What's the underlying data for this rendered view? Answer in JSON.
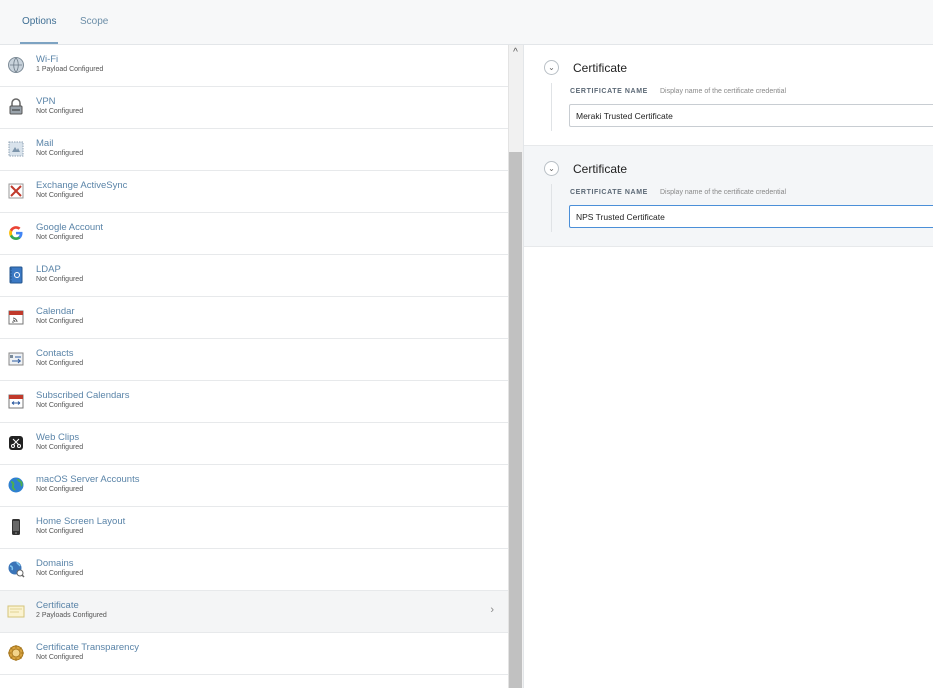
{
  "tabs": [
    {
      "label": "Options",
      "active": true
    },
    {
      "label": "Scope",
      "active": false
    }
  ],
  "payloads": [
    {
      "title": "Wi-Fi",
      "status": "1 Payload Configured",
      "icon": "wifi-globe-icon"
    },
    {
      "title": "VPN",
      "status": "Not Configured",
      "icon": "vpn-lock-icon"
    },
    {
      "title": "Mail",
      "status": "Not Configured",
      "icon": "mail-stamp-icon"
    },
    {
      "title": "Exchange ActiveSync",
      "status": "Not Configured",
      "icon": "exchange-icon"
    },
    {
      "title": "Google Account",
      "status": "Not Configured",
      "icon": "google-icon"
    },
    {
      "title": "LDAP",
      "status": "Not Configured",
      "icon": "ldap-book-icon"
    },
    {
      "title": "Calendar",
      "status": "Not Configured",
      "icon": "calendar-icon"
    },
    {
      "title": "Contacts",
      "status": "Not Configured",
      "icon": "contacts-icon"
    },
    {
      "title": "Subscribed Calendars",
      "status": "Not Configured",
      "icon": "subscribed-calendar-icon"
    },
    {
      "title": "Web Clips",
      "status": "Not Configured",
      "icon": "web-clips-icon"
    },
    {
      "title": "macOS Server Accounts",
      "status": "Not Configured",
      "icon": "server-globe-icon"
    },
    {
      "title": "Home Screen Layout",
      "status": "Not Configured",
      "icon": "phone-icon"
    },
    {
      "title": "Domains",
      "status": "Not Configured",
      "icon": "domains-globe-icon"
    },
    {
      "title": "Certificate",
      "status": "2 Payloads Configured",
      "icon": "certificate-icon",
      "selected": true
    },
    {
      "title": "Certificate Transparency",
      "status": "Not Configured",
      "icon": "gear-badge-icon"
    }
  ],
  "certificates": [
    {
      "heading": "Certificate",
      "field_label": "CERTIFICATE NAME",
      "field_hint": "Display name of the certificate credential",
      "value": "Meraki Trusted Certificate"
    },
    {
      "heading": "Certificate",
      "field_label": "CERTIFICATE NAME",
      "field_hint": "Display name of the certificate credential",
      "value": "NPS Trusted Certificate"
    }
  ],
  "colors": {
    "link_blue": "#5a84a8",
    "focus_blue": "#4b8fd8",
    "selected_row": "#f4f5f6"
  }
}
